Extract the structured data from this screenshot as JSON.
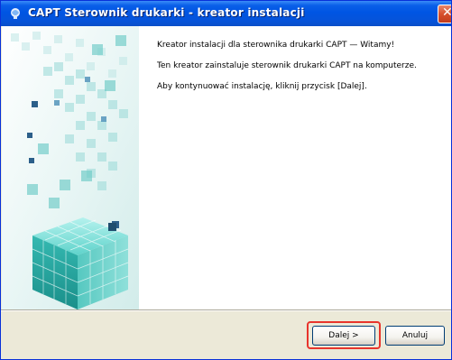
{
  "window": {
    "title": "CAPT Sterownik drukarki - kreator instalacji"
  },
  "main": {
    "heading": "Kreator instalacji dla sterownika drukarki CAPT — Witamy!",
    "paragraph1": "Ten kreator zainstaluje sterownik drukarki CAPT na komputerze.",
    "paragraph2": "Aby kontynuować instalację, kliknij przycisk [Dalej]."
  },
  "buttons": {
    "next_label": "Dalej >",
    "cancel_label": "Anuluj"
  },
  "colors": {
    "title_bar": "#0055e3",
    "highlight": "#e8342c",
    "accent_teal": "#2fb7b0"
  }
}
